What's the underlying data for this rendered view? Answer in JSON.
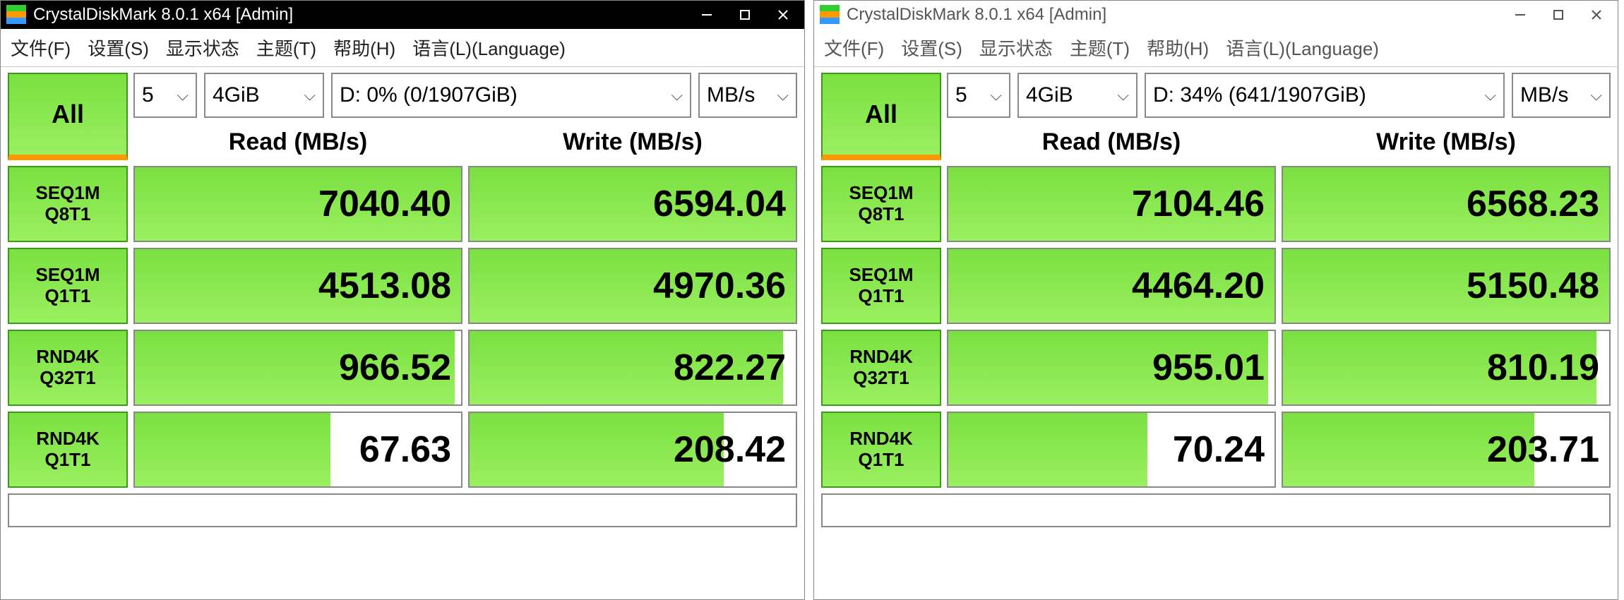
{
  "windows": [
    {
      "theme": "dark",
      "title": "CrystalDiskMark 8.0.1 x64 [Admin]",
      "menu": [
        "文件(F)",
        "设置(S)",
        "显示状态",
        "主题(T)",
        "帮助(H)",
        "语言(L)(Language)"
      ],
      "all_label": "All",
      "runs": "5",
      "size": "4GiB",
      "drive": "D: 0% (0/1907GiB)",
      "unit": "MB/s",
      "read_header": "Read (MB/s)",
      "write_header": "Write (MB/s)",
      "rows": [
        {
          "label1": "SEQ1M",
          "label2": "Q8T1",
          "read": "7040.40",
          "read_fill": 100,
          "write": "6594.04",
          "write_fill": 100
        },
        {
          "label1": "SEQ1M",
          "label2": "Q1T1",
          "read": "4513.08",
          "read_fill": 100,
          "write": "4970.36",
          "write_fill": 100
        },
        {
          "label1": "RND4K",
          "label2": "Q32T1",
          "read": "966.52",
          "read_fill": 98,
          "write": "822.27",
          "write_fill": 96
        },
        {
          "label1": "RND4K",
          "label2": "Q1T1",
          "read": "67.63",
          "read_fill": 60,
          "write": "208.42",
          "write_fill": 78
        }
      ]
    },
    {
      "theme": "light",
      "title": "CrystalDiskMark 8.0.1 x64 [Admin]",
      "menu": [
        "文件(F)",
        "设置(S)",
        "显示状态",
        "主题(T)",
        "帮助(H)",
        "语言(L)(Language)"
      ],
      "all_label": "All",
      "runs": "5",
      "size": "4GiB",
      "drive": "D: 34% (641/1907GiB)",
      "unit": "MB/s",
      "read_header": "Read (MB/s)",
      "write_header": "Write (MB/s)",
      "rows": [
        {
          "label1": "SEQ1M",
          "label2": "Q8T1",
          "read": "7104.46",
          "read_fill": 100,
          "write": "6568.23",
          "write_fill": 100
        },
        {
          "label1": "SEQ1M",
          "label2": "Q1T1",
          "read": "4464.20",
          "read_fill": 100,
          "write": "5150.48",
          "write_fill": 100
        },
        {
          "label1": "RND4K",
          "label2": "Q32T1",
          "read": "955.01",
          "read_fill": 98,
          "write": "810.19",
          "write_fill": 96
        },
        {
          "label1": "RND4K",
          "label2": "Q1T1",
          "read": "70.24",
          "read_fill": 61,
          "write": "203.71",
          "write_fill": 77
        }
      ]
    }
  ]
}
